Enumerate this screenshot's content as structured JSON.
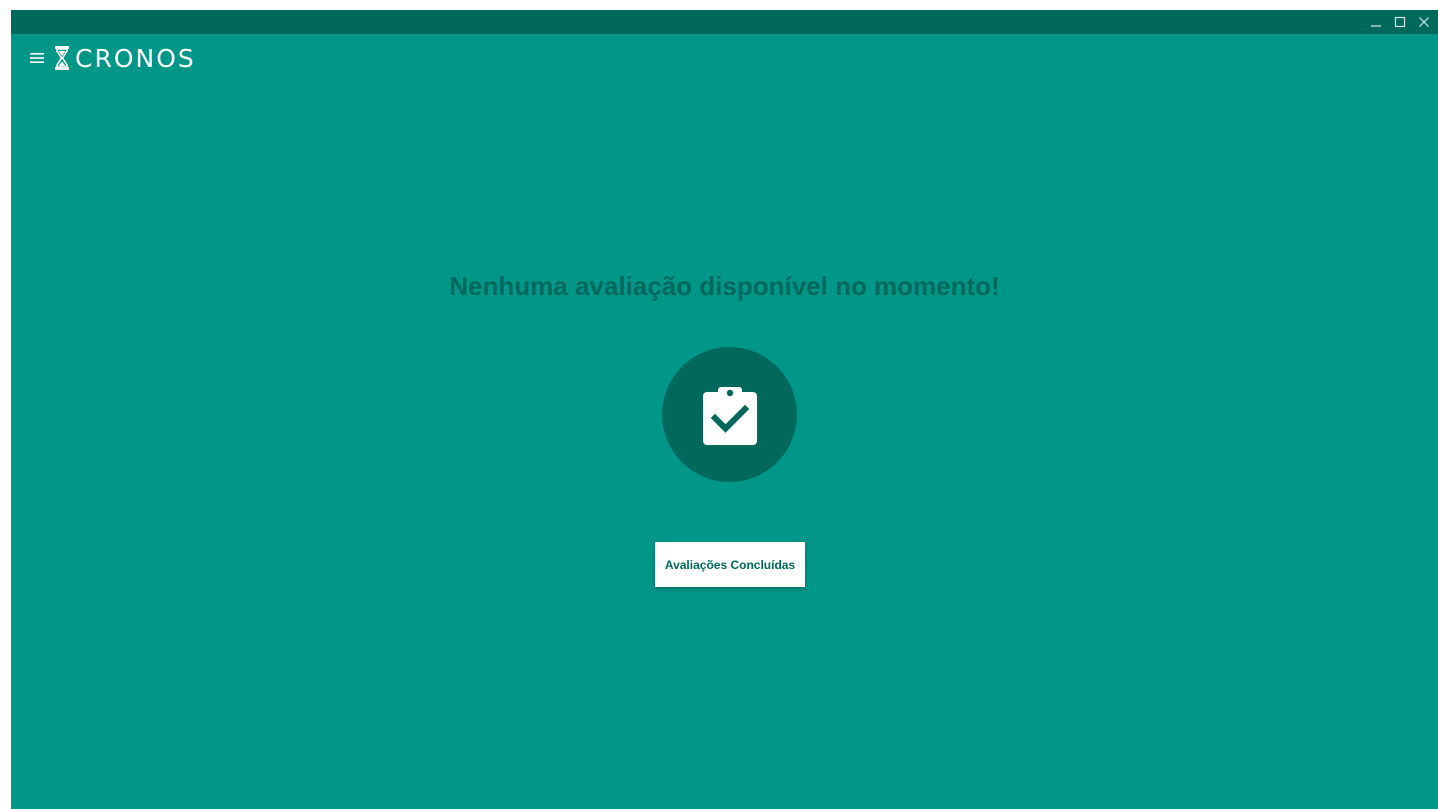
{
  "app": {
    "name": "CRONOS"
  },
  "window_controls": {
    "minimize_icon": "minimize-icon",
    "maximize_icon": "maximize-icon",
    "close_icon": "close-icon"
  },
  "appbar": {
    "menu_icon": "hamburger-menu-icon",
    "logo_icon": "hourglass-icon"
  },
  "main": {
    "message": "Nenhuma avaliação disponível no momento!",
    "status_icon": "clipboard-check-icon",
    "button_label": "Avaliações Concluídas"
  },
  "colors": {
    "background": "#009688",
    "titlebar": "#00695c",
    "accent_dark": "#00695c",
    "button_bg": "#ffffff"
  }
}
